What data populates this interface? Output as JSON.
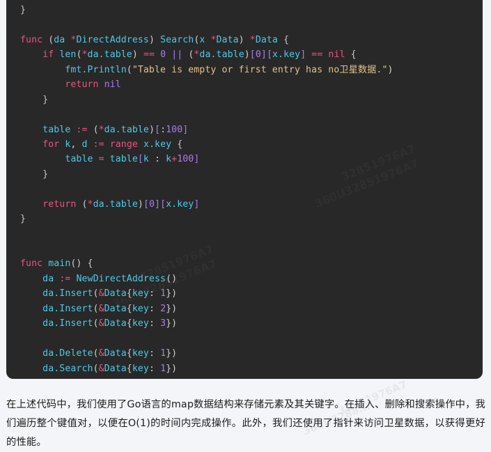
{
  "theme": {
    "page_background": "#f4f5f9",
    "code_background": "#282828",
    "keyword_color": "#e8557f",
    "identifier_color": "#4ec9e8",
    "number_color": "#a97ced",
    "string_color": "#e2c08d",
    "plain_color": "#d8d8d8",
    "paragraph_color": "#1b1b1b"
  },
  "watermark": {
    "id_short": "32851976A7",
    "id_long": "360U32851976A7",
    "page_mark": "360U3288..."
  },
  "code_block": {
    "language": "go",
    "lines": [
      {
        "indent": 0,
        "tokens": [
          {
            "t": "}",
            "c": "br"
          }
        ]
      },
      {
        "indent": 0,
        "tokens": []
      },
      {
        "indent": 0,
        "tokens": [
          {
            "t": "func",
            "c": "kw"
          },
          {
            "t": " ",
            "c": "pn"
          },
          {
            "t": "(",
            "c": "pn"
          },
          {
            "t": "da",
            "c": "id"
          },
          {
            "t": " ",
            "c": "pn"
          },
          {
            "t": "*",
            "c": "op"
          },
          {
            "t": "DirectAddress",
            "c": "id"
          },
          {
            "t": ")",
            "c": "pn"
          },
          {
            "t": " ",
            "c": "pn"
          },
          {
            "t": "Search",
            "c": "id"
          },
          {
            "t": "(",
            "c": "pn"
          },
          {
            "t": "x",
            "c": "id"
          },
          {
            "t": " ",
            "c": "pn"
          },
          {
            "t": "*",
            "c": "op"
          },
          {
            "t": "Data",
            "c": "id"
          },
          {
            "t": ")",
            "c": "pn"
          },
          {
            "t": " ",
            "c": "pn"
          },
          {
            "t": "*",
            "c": "op"
          },
          {
            "t": "Data",
            "c": "id"
          },
          {
            "t": " ",
            "c": "pn"
          },
          {
            "t": "{",
            "c": "br"
          }
        ]
      },
      {
        "indent": 1,
        "tokens": [
          {
            "t": "if",
            "c": "kw"
          },
          {
            "t": " ",
            "c": "pn"
          },
          {
            "t": "len",
            "c": "id"
          },
          {
            "t": "(",
            "c": "pn"
          },
          {
            "t": "*",
            "c": "op"
          },
          {
            "t": "da.table",
            "c": "id"
          },
          {
            "t": ")",
            "c": "pn"
          },
          {
            "t": " ",
            "c": "pn"
          },
          {
            "t": "==",
            "c": "op"
          },
          {
            "t": " ",
            "c": "pn"
          },
          {
            "t": "0",
            "c": "num"
          },
          {
            "t": " ",
            "c": "pn"
          },
          {
            "t": "||",
            "c": "num"
          },
          {
            "t": " ",
            "c": "pn"
          },
          {
            "t": "(",
            "c": "pn"
          },
          {
            "t": "*",
            "c": "op"
          },
          {
            "t": "da.table",
            "c": "id"
          },
          {
            "t": ")",
            "c": "pn"
          },
          {
            "t": "[",
            "c": "num"
          },
          {
            "t": "0",
            "c": "num"
          },
          {
            "t": "]",
            "c": "num"
          },
          {
            "t": "[",
            "c": "num"
          },
          {
            "t": "x.key",
            "c": "id"
          },
          {
            "t": "]",
            "c": "num"
          },
          {
            "t": " ",
            "c": "pn"
          },
          {
            "t": "==",
            "c": "op"
          },
          {
            "t": " ",
            "c": "pn"
          },
          {
            "t": "nil",
            "c": "kw"
          },
          {
            "t": " ",
            "c": "pn"
          },
          {
            "t": "{",
            "c": "br"
          }
        ]
      },
      {
        "indent": 2,
        "tokens": [
          {
            "t": "fmt.Println",
            "c": "id"
          },
          {
            "t": "(",
            "c": "pn"
          },
          {
            "t": "\"Table is empty or first entry has no卫星数据.\"",
            "c": "str"
          },
          {
            "t": ")",
            "c": "pn"
          }
        ]
      },
      {
        "indent": 2,
        "tokens": [
          {
            "t": "return",
            "c": "kw"
          },
          {
            "t": " ",
            "c": "pn"
          },
          {
            "t": "nil",
            "c": "num"
          }
        ]
      },
      {
        "indent": 1,
        "tokens": [
          {
            "t": "}",
            "c": "br"
          }
        ]
      },
      {
        "indent": 0,
        "tokens": []
      },
      {
        "indent": 1,
        "tokens": [
          {
            "t": "table",
            "c": "id"
          },
          {
            "t": " ",
            "c": "pn"
          },
          {
            "t": ":=",
            "c": "op"
          },
          {
            "t": " ",
            "c": "pn"
          },
          {
            "t": "(",
            "c": "pn"
          },
          {
            "t": "*",
            "c": "op"
          },
          {
            "t": "da.table",
            "c": "id"
          },
          {
            "t": ")",
            "c": "pn"
          },
          {
            "t": "[",
            "c": "num"
          },
          {
            "t": ":",
            "c": "pn"
          },
          {
            "t": "100",
            "c": "num"
          },
          {
            "t": "]",
            "c": "num"
          }
        ]
      },
      {
        "indent": 1,
        "tokens": [
          {
            "t": "for",
            "c": "kw"
          },
          {
            "t": " ",
            "c": "pn"
          },
          {
            "t": "k",
            "c": "id"
          },
          {
            "t": ",",
            "c": "pn"
          },
          {
            "t": " ",
            "c": "pn"
          },
          {
            "t": "d",
            "c": "id"
          },
          {
            "t": " ",
            "c": "pn"
          },
          {
            "t": ":=",
            "c": "op"
          },
          {
            "t": " ",
            "c": "pn"
          },
          {
            "t": "range",
            "c": "kw"
          },
          {
            "t": " ",
            "c": "pn"
          },
          {
            "t": "x.key",
            "c": "id"
          },
          {
            "t": " ",
            "c": "pn"
          },
          {
            "t": "{",
            "c": "br"
          }
        ]
      },
      {
        "indent": 2,
        "tokens": [
          {
            "t": "table",
            "c": "id"
          },
          {
            "t": " ",
            "c": "pn"
          },
          {
            "t": "=",
            "c": "op"
          },
          {
            "t": " ",
            "c": "pn"
          },
          {
            "t": "table",
            "c": "id"
          },
          {
            "t": "[",
            "c": "num"
          },
          {
            "t": "k",
            "c": "id"
          },
          {
            "t": " : ",
            "c": "pn"
          },
          {
            "t": "k",
            "c": "id"
          },
          {
            "t": "+",
            "c": "op"
          },
          {
            "t": "100",
            "c": "num"
          },
          {
            "t": "]",
            "c": "num"
          }
        ]
      },
      {
        "indent": 1,
        "tokens": [
          {
            "t": "}",
            "c": "br"
          }
        ]
      },
      {
        "indent": 0,
        "tokens": []
      },
      {
        "indent": 1,
        "tokens": [
          {
            "t": "return",
            "c": "kw"
          },
          {
            "t": " ",
            "c": "pn"
          },
          {
            "t": "(",
            "c": "pn"
          },
          {
            "t": "*",
            "c": "op"
          },
          {
            "t": "da.table",
            "c": "id"
          },
          {
            "t": ")",
            "c": "pn"
          },
          {
            "t": "[",
            "c": "num"
          },
          {
            "t": "0",
            "c": "num"
          },
          {
            "t": "]",
            "c": "num"
          },
          {
            "t": "[",
            "c": "num"
          },
          {
            "t": "x.key",
            "c": "id"
          },
          {
            "t": "]",
            "c": "num"
          }
        ]
      },
      {
        "indent": 0,
        "tokens": [
          {
            "t": "}",
            "c": "br"
          }
        ]
      },
      {
        "indent": 0,
        "tokens": []
      },
      {
        "indent": 0,
        "tokens": []
      },
      {
        "indent": 0,
        "tokens": [
          {
            "t": "func",
            "c": "kw"
          },
          {
            "t": " ",
            "c": "pn"
          },
          {
            "t": "main",
            "c": "id"
          },
          {
            "t": "()",
            "c": "pn"
          },
          {
            "t": " ",
            "c": "pn"
          },
          {
            "t": "{",
            "c": "br"
          }
        ]
      },
      {
        "indent": 1,
        "tokens": [
          {
            "t": "da",
            "c": "id"
          },
          {
            "t": " ",
            "c": "pn"
          },
          {
            "t": ":=",
            "c": "op"
          },
          {
            "t": " ",
            "c": "pn"
          },
          {
            "t": "NewDirectAddress",
            "c": "id"
          },
          {
            "t": "()",
            "c": "pn"
          }
        ]
      },
      {
        "indent": 1,
        "tokens": [
          {
            "t": "da.Insert",
            "c": "id"
          },
          {
            "t": "(",
            "c": "pn"
          },
          {
            "t": "&",
            "c": "op"
          },
          {
            "t": "Data",
            "c": "id"
          },
          {
            "t": "{",
            "c": "pn"
          },
          {
            "t": "key",
            "c": "id"
          },
          {
            "t": ": ",
            "c": "pn"
          },
          {
            "t": "1",
            "c": "num"
          },
          {
            "t": "}",
            "c": "pn"
          },
          {
            "t": ")",
            "c": "pn"
          }
        ]
      },
      {
        "indent": 1,
        "tokens": [
          {
            "t": "da.Insert",
            "c": "id"
          },
          {
            "t": "(",
            "c": "pn"
          },
          {
            "t": "&",
            "c": "op"
          },
          {
            "t": "Data",
            "c": "id"
          },
          {
            "t": "{",
            "c": "pn"
          },
          {
            "t": "key",
            "c": "id"
          },
          {
            "t": ": ",
            "c": "pn"
          },
          {
            "t": "2",
            "c": "num"
          },
          {
            "t": "}",
            "c": "pn"
          },
          {
            "t": ")",
            "c": "pn"
          }
        ]
      },
      {
        "indent": 1,
        "tokens": [
          {
            "t": "da.Insert",
            "c": "id"
          },
          {
            "t": "(",
            "c": "pn"
          },
          {
            "t": "&",
            "c": "op"
          },
          {
            "t": "Data",
            "c": "id"
          },
          {
            "t": "{",
            "c": "pn"
          },
          {
            "t": "key",
            "c": "id"
          },
          {
            "t": ": ",
            "c": "pn"
          },
          {
            "t": "3",
            "c": "num"
          },
          {
            "t": "}",
            "c": "pn"
          },
          {
            "t": ")",
            "c": "pn"
          }
        ]
      },
      {
        "indent": 0,
        "tokens": []
      },
      {
        "indent": 1,
        "tokens": [
          {
            "t": "da.Delete",
            "c": "id"
          },
          {
            "t": "(",
            "c": "pn"
          },
          {
            "t": "&",
            "c": "op"
          },
          {
            "t": "Data",
            "c": "id"
          },
          {
            "t": "{",
            "c": "pn"
          },
          {
            "t": "key",
            "c": "id"
          },
          {
            "t": ": ",
            "c": "pn"
          },
          {
            "t": "1",
            "c": "num"
          },
          {
            "t": "}",
            "c": "pn"
          },
          {
            "t": ")",
            "c": "pn"
          }
        ]
      },
      {
        "indent": 1,
        "tokens": [
          {
            "t": "da.Search",
            "c": "id"
          },
          {
            "t": "(",
            "c": "pn"
          },
          {
            "t": "&",
            "c": "op"
          },
          {
            "t": "Data",
            "c": "id"
          },
          {
            "t": "{",
            "c": "pn"
          },
          {
            "t": "key",
            "c": "id"
          },
          {
            "t": ": ",
            "c": "pn"
          },
          {
            "t": "1",
            "c": "num"
          },
          {
            "t": "}",
            "c": "pn"
          },
          {
            "t": ")",
            "c": "pn"
          }
        ]
      },
      {
        "indent": 0,
        "tokens": [
          {
            "t": "}",
            "c": "br"
          }
        ]
      }
    ]
  },
  "paragraph": {
    "text": "在上述代码中，我们使用了Go语言的map数据结构来存储元素及其关键字。在插入、删除和搜索操作中，我们遍历整个键值对，以便在O(1)的时间内完成操作。此外，我们还使用了指针来访问卫星数据，以获得更好的性能。"
  }
}
